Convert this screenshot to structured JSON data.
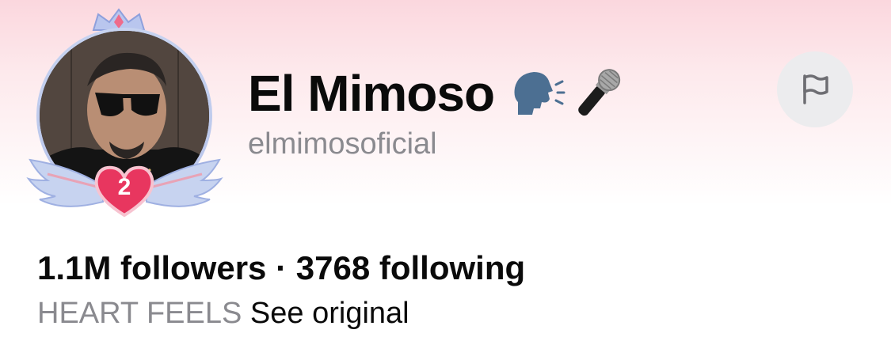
{
  "profile": {
    "display_name": "El Mimoso",
    "username": "elmimosoficial",
    "badge_level": "2",
    "emojis": [
      "speaking-head-icon",
      "microphone-icon"
    ]
  },
  "stats": {
    "followers": "1.1M",
    "followers_label": "followers",
    "separator": "·",
    "following": "3768",
    "following_label": "following"
  },
  "bio": {
    "text": "HEART FEELS",
    "see_original": "See original"
  },
  "actions": {
    "report_icon": "flag-icon"
  },
  "colors": {
    "muted_text": "#8a8a8f",
    "badge_heart": "#e8365f",
    "wing": "#c7d3f0"
  }
}
